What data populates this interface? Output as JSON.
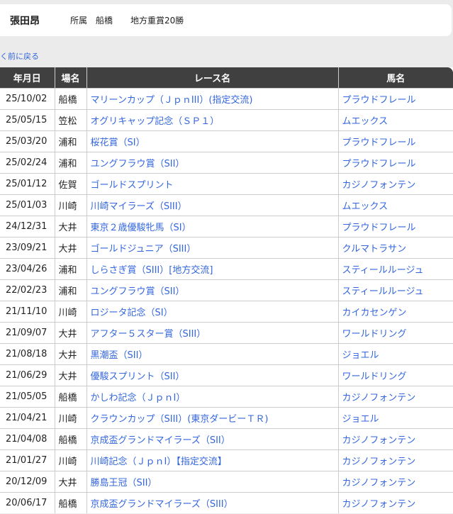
{
  "jockey": {
    "name": "張田昂",
    "affiliation": "所属　船橋",
    "wins": "地方重賞20勝"
  },
  "back_label": "く前に戻る",
  "columns": [
    "年月日",
    "場名",
    "レース名",
    "馬名"
  ],
  "rows": [
    [
      "25/10/02",
      "船橋",
      "マリーンカップ（ＪｐｎIII）(指定交流)",
      "プラウドフレール"
    ],
    [
      "25/05/15",
      "笠松",
      "オグリキャップ記念（ＳＰ１）",
      "ムエックス"
    ],
    [
      "25/03/20",
      "浦和",
      "桜花賞（SI）",
      "プラウドフレール"
    ],
    [
      "25/02/24",
      "浦和",
      "ユングフラウ賞（SII）",
      "プラウドフレール"
    ],
    [
      "25/01/12",
      "佐賀",
      "ゴールドスプリント",
      "カジノフォンテン"
    ],
    [
      "25/01/03",
      "川崎",
      "川崎マイラーズ（SIII）",
      "ムエックス"
    ],
    [
      "24/12/31",
      "大井",
      "東京２歳優駿牝馬（SI）",
      "プラウドフレール"
    ],
    [
      "23/09/21",
      "大井",
      "ゴールドジュニア（SIII）",
      "クルマトラサン"
    ],
    [
      "23/04/26",
      "浦和",
      "しらさぎ賞（SIII）[地方交流]",
      "スティールルージュ"
    ],
    [
      "22/02/23",
      "浦和",
      "ユングフラウ賞（SII）",
      "スティールルージュ"
    ],
    [
      "21/11/10",
      "川崎",
      "ロジータ記念（SI）",
      "カイカセンゲン"
    ],
    [
      "21/09/07",
      "大井",
      "アフター５スター賞（SIII）",
      "ワールドリング"
    ],
    [
      "21/08/18",
      "大井",
      "黒潮盃（SII）",
      "ジョエル"
    ],
    [
      "21/06/29",
      "大井",
      "優駿スプリント（SII）",
      "ワールドリング"
    ],
    [
      "21/05/05",
      "船橋",
      "かしわ記念（ＪｐｎI）",
      "カジノフォンテン"
    ],
    [
      "21/04/21",
      "川崎",
      "クラウンカップ（SIII）(東京ダービーＴＲ)",
      "ジョエル"
    ],
    [
      "21/04/08",
      "船橋",
      "京成盃グランドマイラーズ（SII）",
      "カジノフォンテン"
    ],
    [
      "21/01/27",
      "川崎",
      "川崎記念（ＪｐｎI）【指定交流】",
      "カジノフォンテン"
    ],
    [
      "20/12/09",
      "大井",
      "勝島王冠（SII）",
      "カジノフォンテン"
    ],
    [
      "20/06/17",
      "船橋",
      "京成盃グランドマイラーズ（SIII）",
      "カジノフォンテン"
    ]
  ]
}
